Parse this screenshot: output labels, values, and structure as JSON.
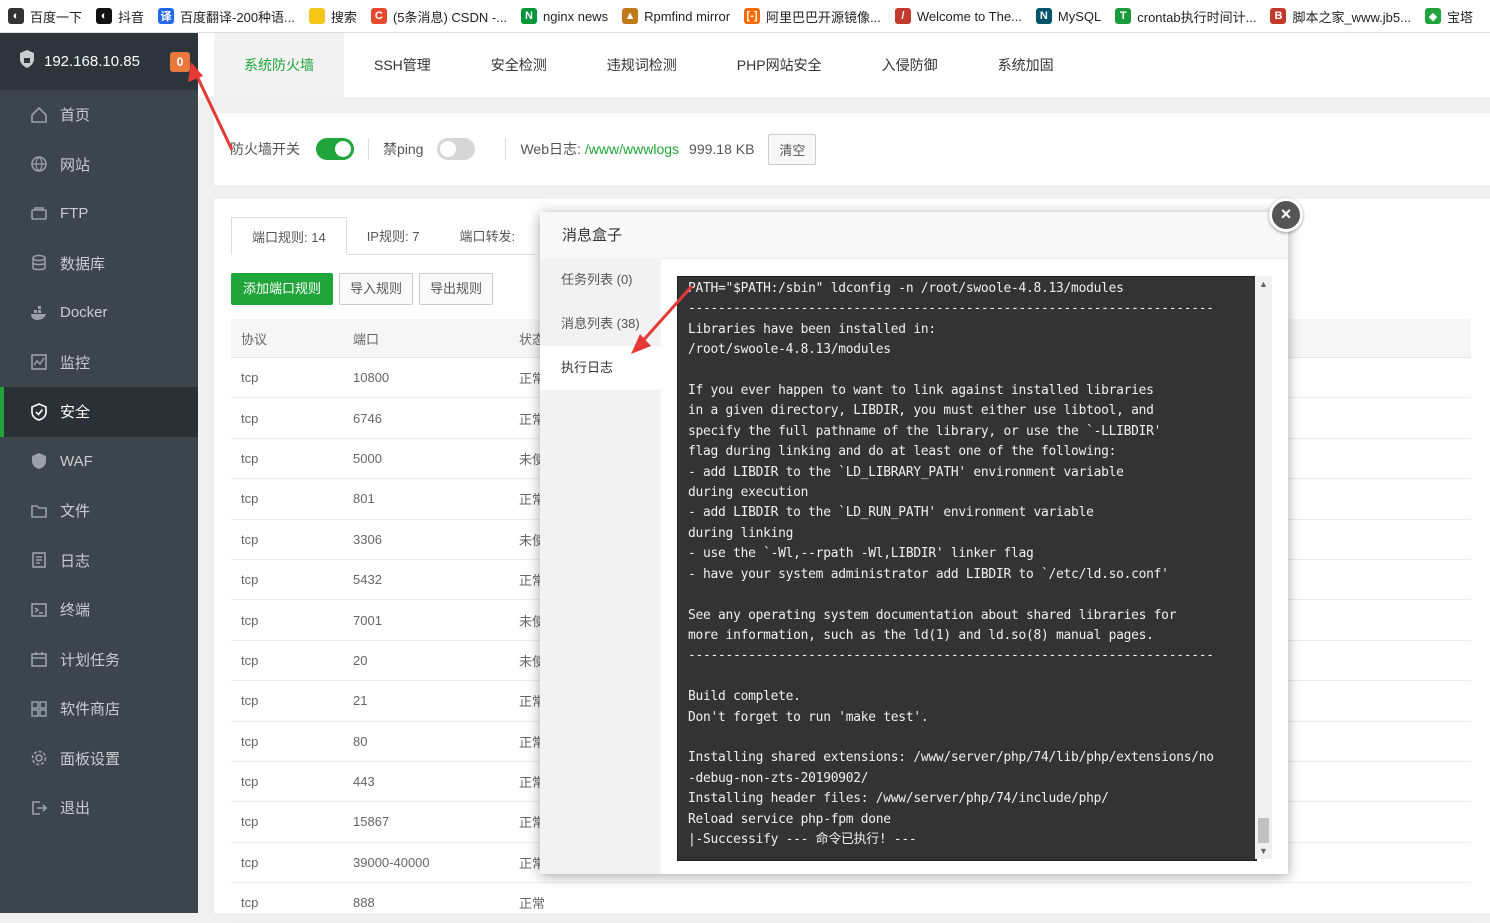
{
  "bookmarks": [
    {
      "label": "百度一下",
      "color": "#333333",
      "glyph": "◐"
    },
    {
      "label": "抖音",
      "color": "#111111",
      "glyph": "◐"
    },
    {
      "label": "百度翻译-200种语...",
      "color": "#2468f2",
      "glyph": "译"
    },
    {
      "label": "搜索",
      "color": "#f5c518",
      "glyph": ""
    },
    {
      "label": "(5条消息) CSDN -...",
      "color": "#e84a30",
      "glyph": "C"
    },
    {
      "label": "nginx news",
      "color": "#009639",
      "glyph": "N"
    },
    {
      "label": "Rpmfind mirror",
      "color": "#c07a1a",
      "glyph": "▲"
    },
    {
      "label": "阿里巴巴开源镜像...",
      "color": "#ff6a00",
      "glyph": "[-]"
    },
    {
      "label": "Welcome to The...",
      "color": "#c0392b",
      "glyph": "/"
    },
    {
      "label": "MySQL",
      "color": "#00546b",
      "glyph": "N"
    },
    {
      "label": "crontab执行时间计...",
      "color": "#1a9c3a",
      "glyph": "T"
    },
    {
      "label": "脚本之家_www.jb5...",
      "color": "#c0392b",
      "glyph": "B"
    },
    {
      "label": "宝塔",
      "color": "#20a53a",
      "glyph": "◆"
    }
  ],
  "sidebar": {
    "host": "192.168.10.85",
    "badge": "0",
    "items": [
      {
        "label": "首页",
        "icon": "home-icon"
      },
      {
        "label": "网站",
        "icon": "globe-icon"
      },
      {
        "label": "FTP",
        "icon": "ftp-icon"
      },
      {
        "label": "数据库",
        "icon": "database-icon"
      },
      {
        "label": "Docker",
        "icon": "docker-icon"
      },
      {
        "label": "监控",
        "icon": "monitor-icon"
      },
      {
        "label": "安全",
        "icon": "shield-icon"
      },
      {
        "label": "WAF",
        "icon": "waf-icon"
      },
      {
        "label": "文件",
        "icon": "folder-icon"
      },
      {
        "label": "日志",
        "icon": "log-icon"
      },
      {
        "label": "终端",
        "icon": "terminal-icon"
      },
      {
        "label": "计划任务",
        "icon": "calendar-icon"
      },
      {
        "label": "软件商店",
        "icon": "apps-icon"
      },
      {
        "label": "面板设置",
        "icon": "gear-icon"
      },
      {
        "label": "退出",
        "icon": "logout-icon"
      }
    ],
    "active_index": 6
  },
  "topnav": {
    "tabs": [
      "系统防火墙",
      "SSH管理",
      "安全检测",
      "违规词检测",
      "PHP网站安全",
      "入侵防御",
      "系统加固"
    ],
    "active_index": 0
  },
  "switchbar": {
    "firewall_label": "防火墙开关",
    "firewall_on": true,
    "ping_label": "禁ping",
    "ping_on": false,
    "weblog_label": "Web日志:",
    "weblog_path": "/www/wwwlogs",
    "weblog_size": "999.18 KB",
    "clear_label": "清空",
    "accent": "#20a53a"
  },
  "rules_panel": {
    "subtabs": [
      "端口规则: 14",
      "IP规则: 7",
      "端口转发:"
    ],
    "buttons": {
      "add": "添加端口规则",
      "import": "导入规则",
      "export": "导出规则"
    },
    "columns": [
      "协议",
      "端口",
      "状态"
    ],
    "rows": [
      {
        "proto": "tcp",
        "port": "10800",
        "status": "正常"
      },
      {
        "proto": "tcp",
        "port": "6746",
        "status": "正常"
      },
      {
        "proto": "tcp",
        "port": "5000",
        "status": "未使"
      },
      {
        "proto": "tcp",
        "port": "801",
        "status": "正常"
      },
      {
        "proto": "tcp",
        "port": "3306",
        "status": "未使"
      },
      {
        "proto": "tcp",
        "port": "5432",
        "status": "正常"
      },
      {
        "proto": "tcp",
        "port": "7001",
        "status": "未使"
      },
      {
        "proto": "tcp",
        "port": "20",
        "status": "未使"
      },
      {
        "proto": "tcp",
        "port": "21",
        "status": "正常"
      },
      {
        "proto": "tcp",
        "port": "80",
        "status": "正常"
      },
      {
        "proto": "tcp",
        "port": "443",
        "status": "正常"
      },
      {
        "proto": "tcp",
        "port": "15867",
        "status": "正常"
      },
      {
        "proto": "tcp",
        "port": "39000-40000",
        "status": "正常"
      },
      {
        "proto": "tcp",
        "port": "888",
        "status": "正常"
      }
    ]
  },
  "modal": {
    "title": "消息盒子",
    "side_items": [
      "任务列表 (0)",
      "消息列表 (38)",
      "执行日志"
    ],
    "active_index": 2,
    "log_lines": [
      "PATH=\"$PATH:/sbin\" ldconfig -n /root/swoole-4.8.13/modules",
      "----------------------------------------------------------------------",
      "Libraries have been installed in:",
      "/root/swoole-4.8.13/modules",
      "",
      "If you ever happen to want to link against installed libraries",
      "in a given directory, LIBDIR, you must either use libtool, and",
      "specify the full pathname of the library, or use the `-LLIBDIR'",
      "flag during linking and do at least one of the following:",
      "- add LIBDIR to the `LD_LIBRARY_PATH' environment variable",
      "during execution",
      "- add LIBDIR to the `LD_RUN_PATH' environment variable",
      "during linking",
      "- use the `-Wl,--rpath -Wl,LIBDIR' linker flag",
      "- have your system administrator add LIBDIR to `/etc/ld.so.conf'",
      "",
      "See any operating system documentation about shared libraries for",
      "more information, such as the ld(1) and ld.so(8) manual pages.",
      "----------------------------------------------------------------------",
      "",
      "Build complete.",
      "Don't forget to run 'make test'.",
      "",
      "Installing shared extensions: /www/server/php/74/lib/php/extensions/no",
      "-debug-non-zts-20190902/",
      "Installing header files: /www/server/php/74/include/php/",
      "Reload service php-fpm done",
      "|-Successify --- 命令已执行! ---"
    ]
  }
}
